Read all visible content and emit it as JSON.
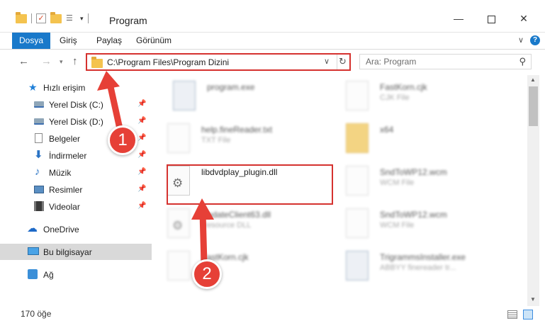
{
  "window": {
    "title": "Program",
    "controls": {
      "minimize": "—",
      "maximize": "",
      "close": "✕"
    }
  },
  "quick_access_toolbar": {
    "dropdown": "▾"
  },
  "ribbon": {
    "tabs": [
      {
        "label": "Dosya",
        "active": true
      },
      {
        "label": "Giriş"
      },
      {
        "label": "Paylaş"
      },
      {
        "label": "Görünüm"
      }
    ],
    "toggle": "∨",
    "help": "?"
  },
  "navigation": {
    "back": "←",
    "forward": "→",
    "recent": "▾",
    "up": "↑"
  },
  "address_bar": {
    "path": "C:\\Program Files\\Program Dizini",
    "dropdown": "∨",
    "refresh": "↻"
  },
  "search": {
    "placeholder": "Ara: Program",
    "icon": "search-icon"
  },
  "nav_pane": {
    "items": [
      {
        "label": "Hızlı erişim",
        "icon": "star-icon"
      },
      {
        "label": "Yerel Disk (C:)",
        "icon": "drive-icon",
        "pinned": true
      },
      {
        "label": "Yerel Disk (D:)",
        "icon": "drive-icon",
        "pinned": true
      },
      {
        "label": "Belgeler",
        "icon": "document-icon",
        "pinned": true
      },
      {
        "label": "İndirmeler",
        "icon": "download-icon",
        "pinned": true
      },
      {
        "label": "Müzik",
        "icon": "music-icon",
        "pinned": true
      },
      {
        "label": "Resimler",
        "icon": "pictures-icon",
        "pinned": true
      },
      {
        "label": "Videolar",
        "icon": "videos-icon",
        "pinned": true
      },
      {
        "label": "OneDrive",
        "icon": "cloud-icon"
      },
      {
        "label": "Bu bilgisayar",
        "icon": "computer-icon",
        "selected": true
      },
      {
        "label": "Ağ",
        "icon": "network-icon"
      }
    ],
    "pin_glyph": "📌"
  },
  "files": [
    {
      "name": "program.exe",
      "type": "",
      "icon": "exe-icon"
    },
    {
      "name": "FastKorn.cjk",
      "type": "CJK File",
      "icon": "file-icon"
    },
    {
      "name": "help.fineReader.txt",
      "type": "TXT File",
      "icon": "file-icon"
    },
    {
      "name": "x64",
      "type": "",
      "icon": "folder-icon"
    },
    {
      "name": "libdvdplay_plugin.dll",
      "type": "",
      "icon": "dll-icon",
      "highlighted": true
    },
    {
      "name": "SndToWP12.wcm",
      "type": "WCM File",
      "icon": "file-icon"
    },
    {
      "name": "UpdateClient63.dll",
      "type": "Resource DLL",
      "icon": "dll-icon"
    },
    {
      "name": "SndToWP12.wcm",
      "type": "WCM File",
      "icon": "file-icon"
    },
    {
      "name": "FastKorn.cjk",
      "type": "",
      "icon": "file-icon"
    },
    {
      "name": "TrigrammsInstaller.exe",
      "type": "ABBYY finereader tr...",
      "icon": "exe-icon"
    }
  ],
  "scrollbar": {
    "up": "▲",
    "down": "▼"
  },
  "status": {
    "count": "170 öğe"
  },
  "annotations": {
    "badge_1": "1",
    "badge_2": "2",
    "color": "#e64037"
  },
  "colors": {
    "accent": "#1979ca",
    "highlight": "#d5322f",
    "selected_nav": "#d9d9d9"
  }
}
